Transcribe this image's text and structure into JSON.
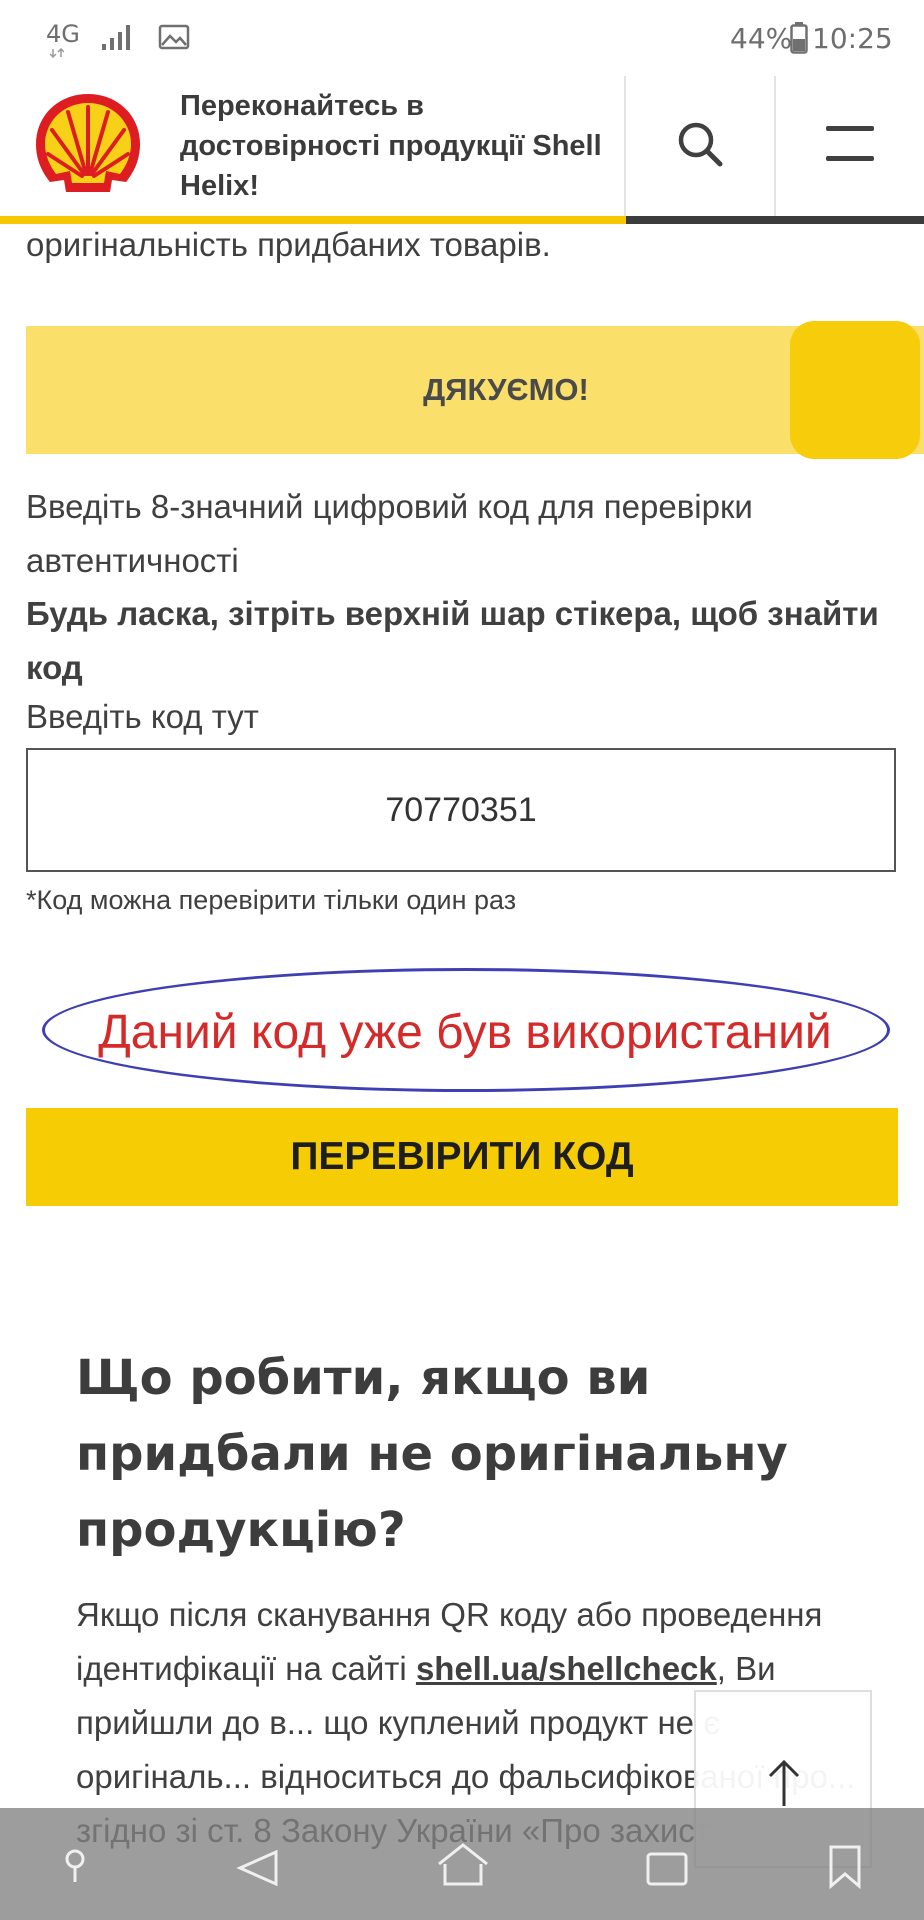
{
  "status_bar": {
    "network": "4G",
    "battery": "44%",
    "time": "10:25"
  },
  "header": {
    "title": "Переконайтесь в достовірності продукції Shell Helix!"
  },
  "content": {
    "intro_tail": "оригінальність придбаних товарів.",
    "thanks_label": "ДЯКУЄМО!",
    "instruction_1": "Введіть 8-значний цифровий код для перевірки автентичності",
    "instruction_2": "Будь ласка, зітріть верхній шар стікера, щоб знайти код",
    "input_label": "Введіть код тут",
    "code_value": "70770351",
    "note": "*Код можна перевірити тільки один раз",
    "error_message": "Даний код уже був використаний",
    "check_button": "ПЕРЕВІРИТИ КОД"
  },
  "section": {
    "heading": "Що робити, якщо ви придбали не оригінальну продукцію?",
    "body_before_link": "Якщо після сканування QR коду або проведення ідентифікації на сайті ",
    "link_text": "shell.ua/shellcheck",
    "body_after_link": ", Ви прийшли до в... що куплений продукт не є оригіналь... відноситься до фальсифікованої про... згідно зі ст. 8 Закону України «Про захист"
  },
  "colors": {
    "brand_yellow": "#f6cd05",
    "brand_red": "#dd1d21",
    "error_red": "#d42a2a",
    "annotation_blue": "#3f3fb4"
  },
  "icons": {
    "search": "search-icon",
    "menu": "hamburger-menu-icon",
    "scroll_top": "arrow-up-icon"
  }
}
